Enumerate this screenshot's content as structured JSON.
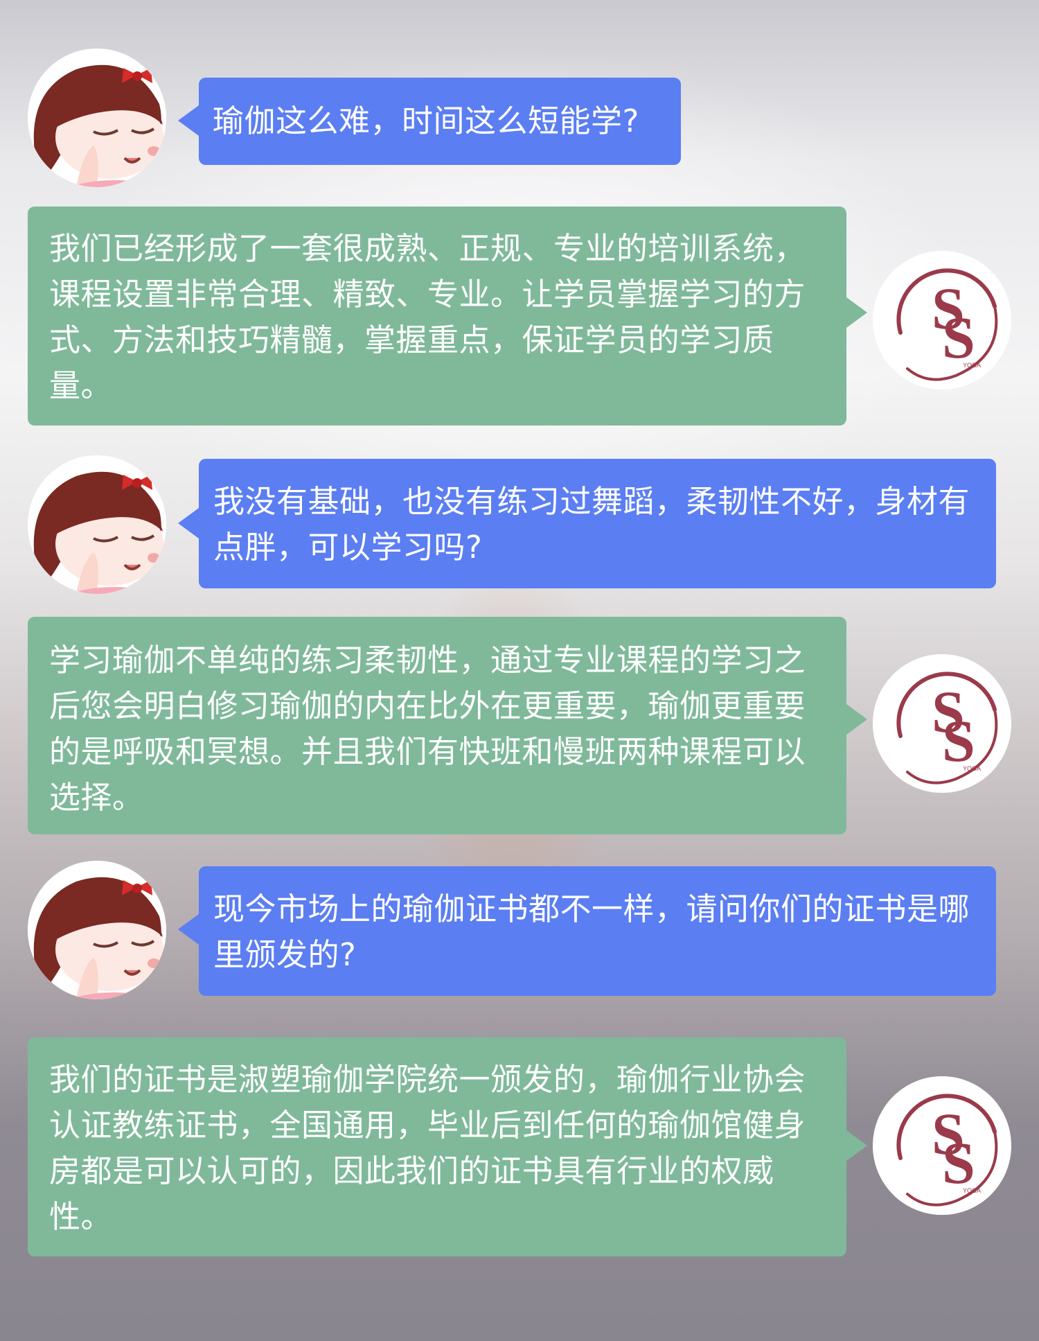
{
  "messages": [
    {
      "role": "user",
      "text": "瑜伽这么难，时间这么短能学?"
    },
    {
      "role": "bot",
      "text": "我们已经形成了一套很成熟、正规、专业的培训系统，课程设置非常合理、精致、专业。让学员掌握学习的方式、方法和技巧精髓，掌握重点，保证学员的学习质量。"
    },
    {
      "role": "user",
      "text": "我没有基础，也没有练习过舞蹈，柔韧性不好，身材有点胖，可以学习吗?"
    },
    {
      "role": "bot",
      "text": "学习瑜伽不单纯的练习柔韧性，通过专业课程的学习之后您会明白修习瑜伽的内在比外在更重要，瑜伽更重要的是呼吸和冥想。并且我们有快班和慢班两种课程可以选择。"
    },
    {
      "role": "user",
      "text": "现今市场上的瑜伽证书都不一样，请问你们的证书是哪里颁发的?"
    },
    {
      "role": "bot",
      "text": "我们的证书是淑塑瑜伽学院统一颁发的，瑜伽行业协会认证教练证书，全国通用，毕业后到任何的瑜伽馆健身房都是可以认可的，因此我们的证书具有行业的权威性。"
    }
  ],
  "logo": {
    "letters": "S S",
    "sub": "YOGA",
    "color": "#9a3a4a"
  },
  "colors": {
    "user_bubble": "#5b7ef2",
    "bot_bubble": "#7fb99a"
  },
  "icons": {
    "user_avatar": "cartoon-girl-avatar",
    "bot_avatar": "ss-yoga-logo"
  }
}
